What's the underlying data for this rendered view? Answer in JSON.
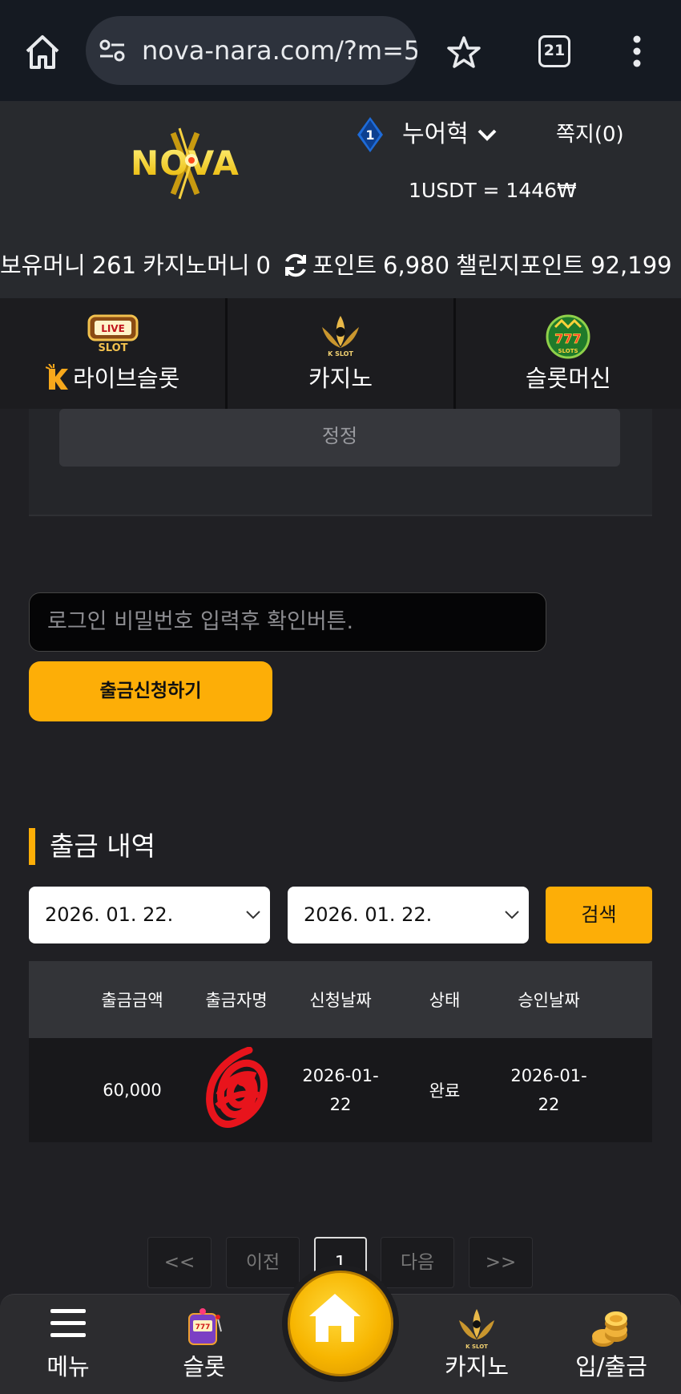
{
  "browser": {
    "url": "nova-nara.com/?m=5",
    "tab_count": "21"
  },
  "header": {
    "logo_text": "NOVA",
    "level": "1",
    "username": "누어혁",
    "messages": "쪽지(0)",
    "rate": "1USDT = 1446₩",
    "balance": {
      "money_label": "보유머니",
      "money_value": "261",
      "casino_label": "카지노머니",
      "casino_value": "0",
      "point_label": "포인트",
      "point_value": "6,980",
      "challenge_label": "챌린지포인트",
      "challenge_value": "92,199"
    }
  },
  "categories": [
    {
      "label": "라이브슬롯",
      "icon": "live-slot-icon",
      "badge_text": "LIVE SLOT"
    },
    {
      "label": "카지노",
      "icon": "k-slot-icon",
      "badge_text": "K SLOT"
    },
    {
      "label": "슬롯머신",
      "icon": "777-slots-icon",
      "badge_text": "777"
    }
  ],
  "form": {
    "correct_label": "정정",
    "password_placeholder": "로그인 비밀번호 입력후 확인버튼.",
    "withdraw_button": "출금신청하기"
  },
  "history": {
    "title": "출금 내역",
    "date_from": "2026. 01. 22.",
    "date_to": "2026. 01. 22.",
    "search_button": "검색",
    "columns": [
      "출금금액",
      "출금자명",
      "신청날짜",
      "상태",
      "승인날짜"
    ],
    "rows": [
      {
        "amount": "60,000",
        "name": "",
        "request_date_1": "2026-01-",
        "request_date_2": "22",
        "status": "완료",
        "approve_date_1": "2026-01-",
        "approve_date_2": "22"
      }
    ]
  },
  "pagination": {
    "first": "<<",
    "prev": "이전",
    "current": "1",
    "next": "다음",
    "last": ">>"
  },
  "bottom_nav": {
    "menu": "메뉴",
    "slot": "슬롯",
    "casino": "카지노",
    "deposit": "입/출금"
  },
  "colors": {
    "accent": "#fdae07",
    "background": "#202024"
  }
}
